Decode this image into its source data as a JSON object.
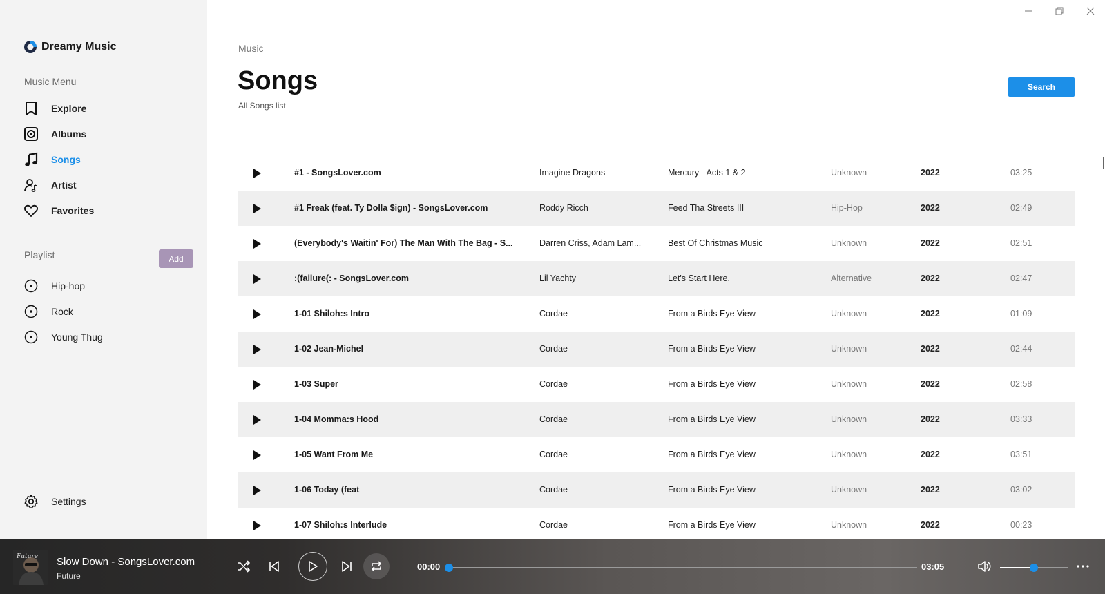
{
  "app": {
    "name": "Dreamy Music"
  },
  "sidebar": {
    "menu_label": "Music Menu",
    "items": [
      {
        "label": "Explore",
        "icon": "bookmark-icon"
      },
      {
        "label": "Albums",
        "icon": "album-icon"
      },
      {
        "label": "Songs",
        "icon": "music-note-icon",
        "active": true
      },
      {
        "label": "Artist",
        "icon": "artist-icon"
      },
      {
        "label": "Favorites",
        "icon": "heart-icon"
      }
    ],
    "playlist_label": "Playlist",
    "add_label": "Add",
    "playlists": [
      {
        "label": "Hip-hop"
      },
      {
        "label": "Rock"
      },
      {
        "label": "Young Thug"
      }
    ],
    "settings_label": "Settings"
  },
  "main": {
    "breadcrumb": "Music",
    "title": "Songs",
    "subtitle": "All Songs list",
    "search_label": "Search",
    "songs": [
      {
        "title": "#1 - SongsLover.com",
        "artist": "Imagine Dragons",
        "album": "Mercury - Acts 1 & 2",
        "genre": "Unknown",
        "year": "2022",
        "duration": "03:25"
      },
      {
        "title": "#1 Freak (feat. Ty Dolla $ign) - SongsLover.com",
        "artist": "Roddy Ricch",
        "album": "Feed Tha Streets III",
        "genre": "Hip-Hop",
        "year": "2022",
        "duration": "02:49"
      },
      {
        "title": "(Everybody's Waitin' For) The Man With The Bag - S...",
        "artist": "Darren Criss, Adam Lam...",
        "album": "Best Of Christmas Music",
        "genre": "Unknown",
        "year": "2022",
        "duration": "02:51"
      },
      {
        "title": ":(failure(: - SongsLover.com",
        "artist": "Lil Yachty",
        "album": "Let's Start Here.",
        "genre": "Alternative",
        "year": "2022",
        "duration": "02:47"
      },
      {
        "title": "1-01 Shiloh:s Intro",
        "artist": "Cordae",
        "album": "From a Birds Eye View",
        "genre": "Unknown",
        "year": "2022",
        "duration": "01:09"
      },
      {
        "title": "1-02 Jean-Michel",
        "artist": "Cordae",
        "album": "From a Birds Eye View",
        "genre": "Unknown",
        "year": "2022",
        "duration": "02:44"
      },
      {
        "title": "1-03 Super",
        "artist": "Cordae",
        "album": "From a Birds Eye View",
        "genre": "Unknown",
        "year": "2022",
        "duration": "02:58"
      },
      {
        "title": "1-04 Momma:s Hood",
        "artist": "Cordae",
        "album": "From a Birds Eye View",
        "genre": "Unknown",
        "year": "2022",
        "duration": "03:33"
      },
      {
        "title": "1-05 Want From Me",
        "artist": "Cordae",
        "album": "From a Birds Eye View",
        "genre": "Unknown",
        "year": "2022",
        "duration": "03:51"
      },
      {
        "title": "1-06 Today (feat",
        "artist": "Cordae",
        "album": "From a Birds Eye View",
        "genre": "Unknown",
        "year": "2022",
        "duration": "03:02"
      },
      {
        "title": "1-07 Shiloh:s Interlude",
        "artist": "Cordae",
        "album": "From a Birds Eye View",
        "genre": "Unknown",
        "year": "2022",
        "duration": "00:23"
      }
    ]
  },
  "player": {
    "track_title": "Slow Down - SongsLover.com",
    "track_artist": "Future",
    "current_time": "00:00",
    "total_time": "03:05",
    "progress": 0,
    "volume": 0.5,
    "accent": "#1c8fe8"
  }
}
